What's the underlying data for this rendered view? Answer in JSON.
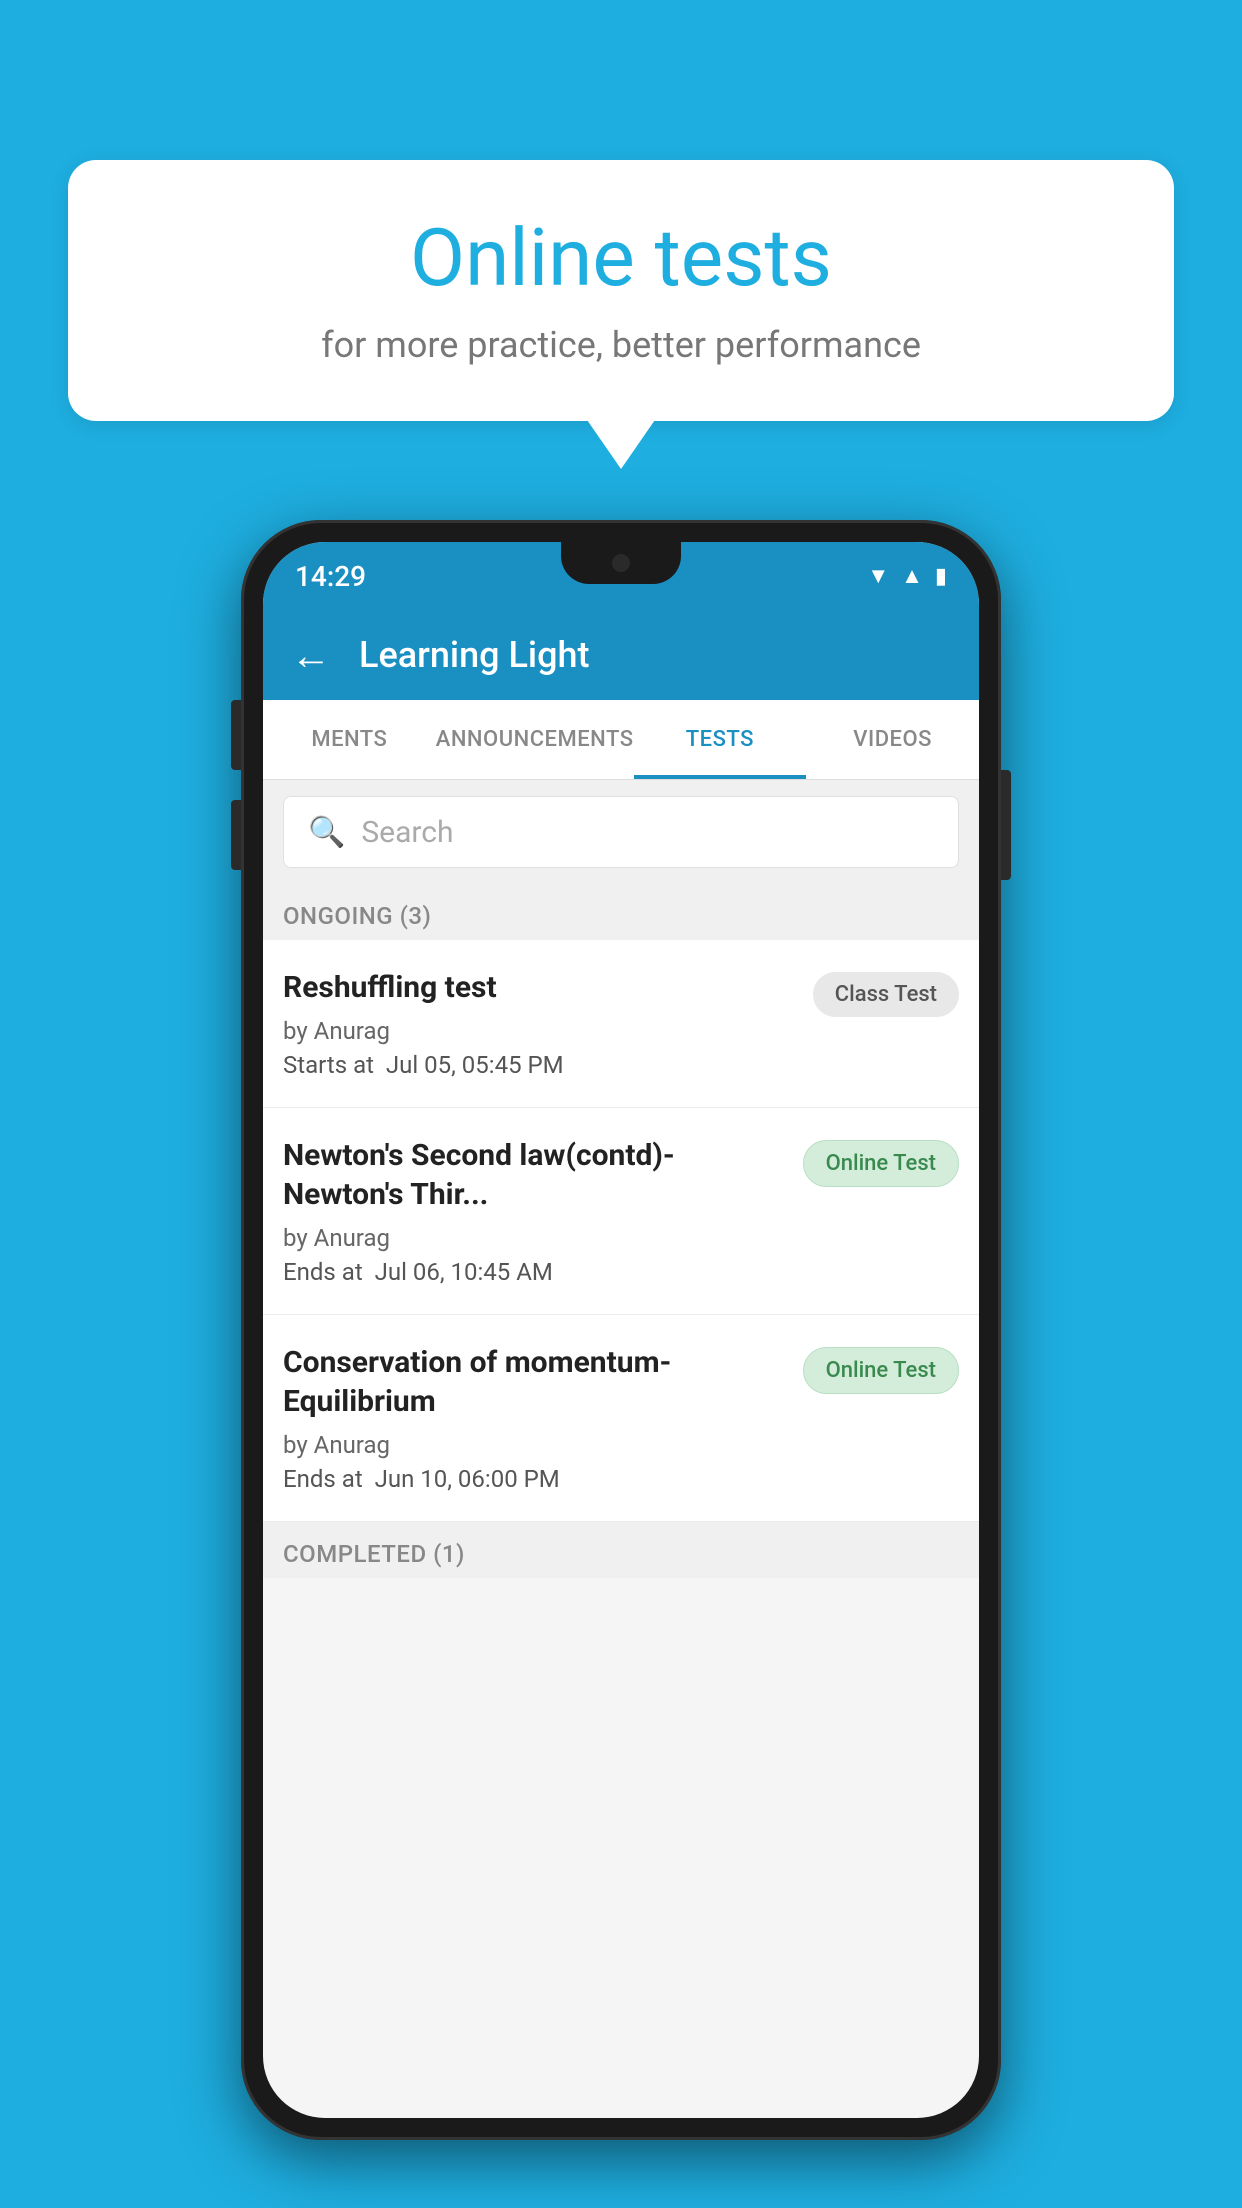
{
  "background_color": "#1EAEE0",
  "speech_bubble": {
    "title": "Online tests",
    "subtitle": "for more practice, better performance"
  },
  "phone": {
    "status_bar": {
      "time": "14:29",
      "icons": [
        "wifi",
        "signal",
        "battery"
      ]
    },
    "app_header": {
      "title": "Learning Light",
      "back_label": "←"
    },
    "tabs": [
      {
        "label": "MENTS",
        "active": false
      },
      {
        "label": "ANNOUNCEMENTS",
        "active": false
      },
      {
        "label": "TESTS",
        "active": true
      },
      {
        "label": "VIDEOS",
        "active": false
      }
    ],
    "search": {
      "placeholder": "Search"
    },
    "section_ongoing": {
      "label": "ONGOING (3)"
    },
    "tests": [
      {
        "name": "Reshuffling test",
        "author": "by Anurag",
        "time_label": "Starts at",
        "time": "Jul 05, 05:45 PM",
        "badge": "Class Test",
        "badge_type": "class"
      },
      {
        "name": "Newton's Second law(contd)-Newton's Thir...",
        "author": "by Anurag",
        "time_label": "Ends at",
        "time": "Jul 06, 10:45 AM",
        "badge": "Online Test",
        "badge_type": "online"
      },
      {
        "name": "Conservation of momentum-Equilibrium",
        "author": "by Anurag",
        "time_label": "Ends at",
        "time": "Jun 10, 06:00 PM",
        "badge": "Online Test",
        "badge_type": "online"
      }
    ],
    "section_completed": {
      "label": "COMPLETED (1)"
    }
  }
}
